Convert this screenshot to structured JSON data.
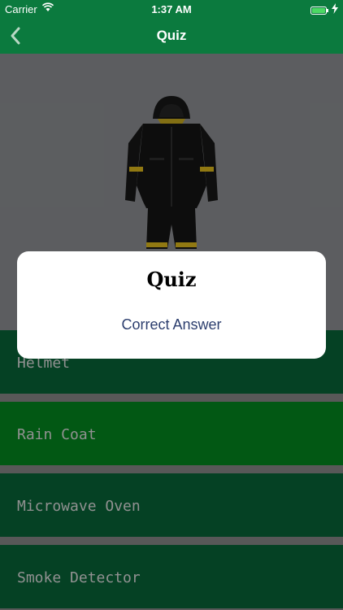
{
  "status_bar": {
    "carrier": "Carrier",
    "time": "1:37 AM",
    "wifi_icon": "wifi-icon",
    "battery_icon": "battery-icon",
    "charging_icon": "bolt-icon"
  },
  "nav_bar": {
    "title": "Quiz",
    "back_icon": "chevron-left-icon"
  },
  "question_image": {
    "subject": "black rain coat with hood and yellow reflective stripes"
  },
  "options": [
    {
      "label": "Helmet",
      "selected": false
    },
    {
      "label": "Rain Coat",
      "selected": true
    },
    {
      "label": "Microwave Oven",
      "selected": false
    },
    {
      "label": "Smoke Detector",
      "selected": false
    }
  ],
  "alert": {
    "title": "Quiz",
    "message": "Correct Answer"
  },
  "colors": {
    "header": "#0b7a3e",
    "option": "#075a33",
    "option_selected": "#047a1d",
    "separator": "#7a7a7a",
    "alert_message": "#2c3e6e"
  }
}
